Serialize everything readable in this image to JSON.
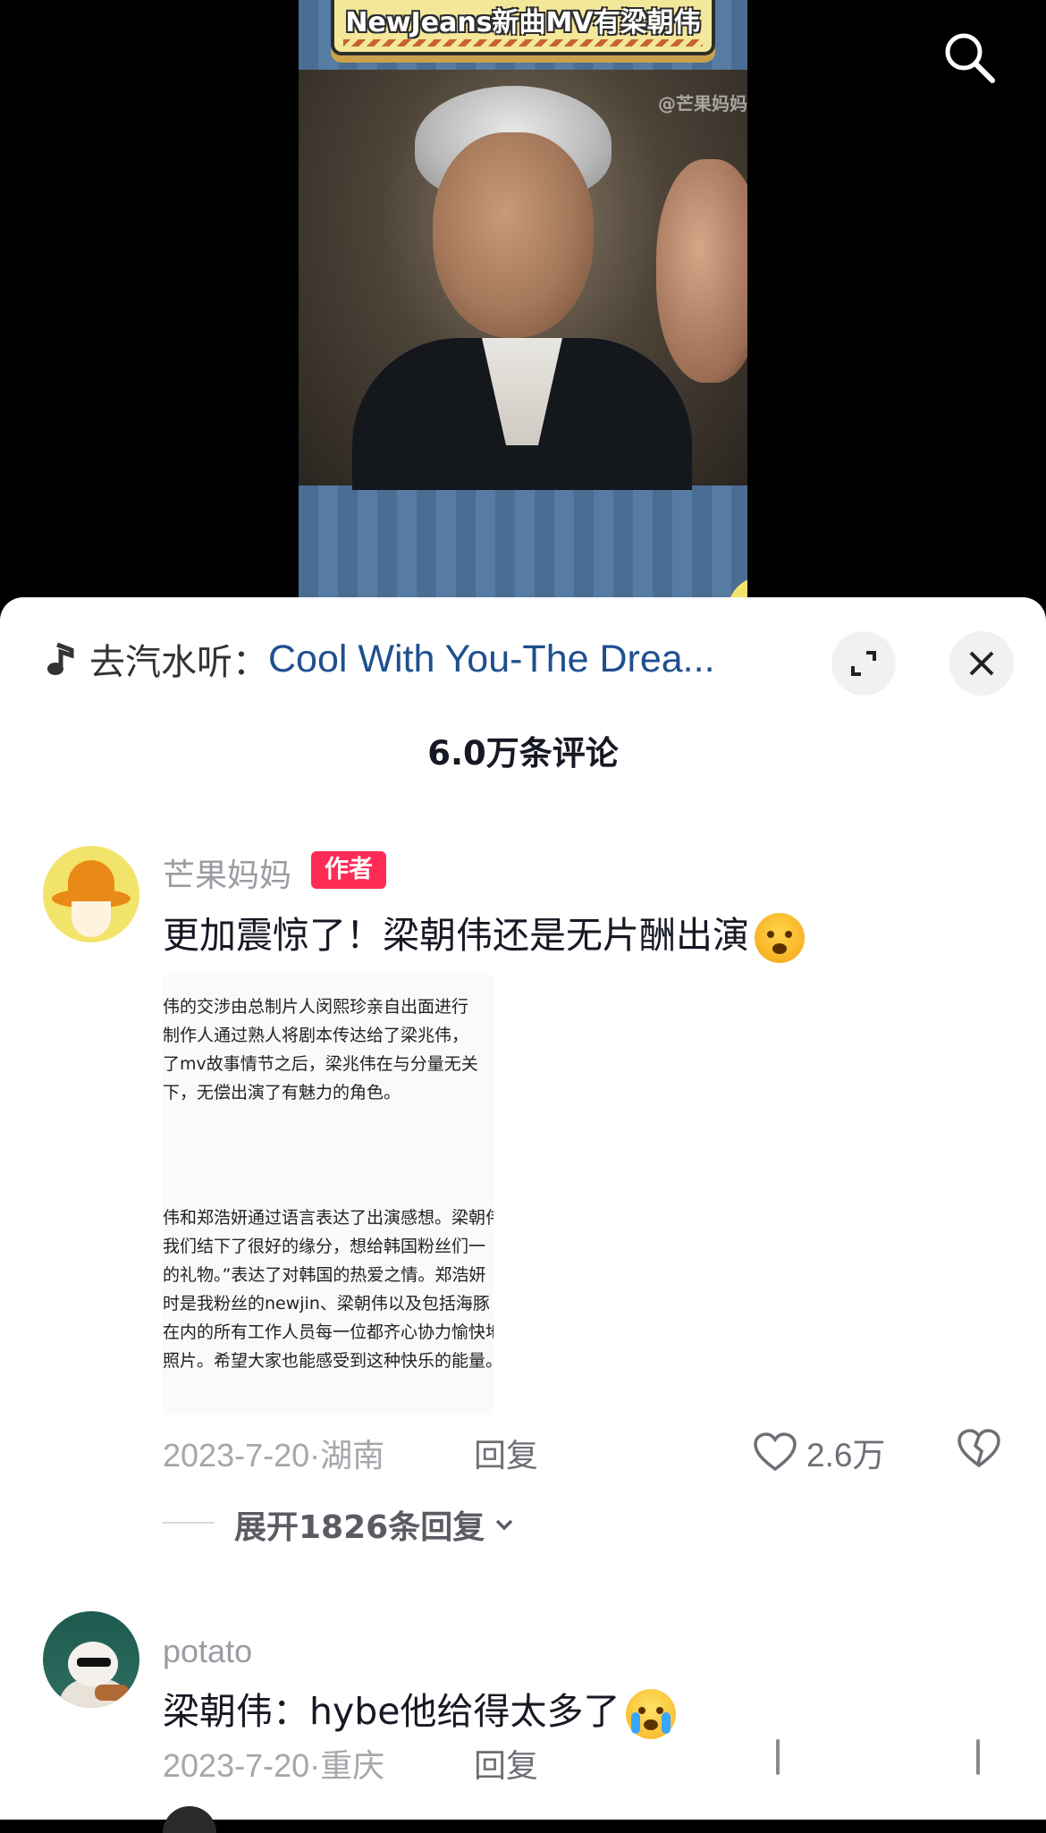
{
  "video": {
    "banner_text": "NewJeans新曲MV有梁朝伟",
    "watermark": "@芒果妈妈"
  },
  "top_bar": {
    "search_icon": "search-icon"
  },
  "music_bar": {
    "icon": "music-note-icon",
    "prefix": "去汽水听：",
    "song_title": "Cool With You-The Drea..."
  },
  "sheet": {
    "comment_count": "6.0万条评论"
  },
  "comments": [
    {
      "username": "芒果妈妈",
      "badge": "作者",
      "text": "更加震惊了！梁朝伟还是无片酬出演",
      "emoji": "angry-face-emoji",
      "image_paragraphs": [
        "伟的交涉由总制片人闵熙珍亲自出面进行\n制作人通过熟人将剧本传达给了梁兆伟，\n了mv故事情节之后，梁兆伟在与分量无关\n下，无偿出演了有魅力的角色。",
        "伟和郑浩妍通过语言表达了出演感想。梁朝伟\n我们结下了很好的缘分，想给韩国粉丝们一\n的礼物。”表达了对韩国的热爱之情。郑浩妍\n时是我粉丝的newjin、梁朝伟以及包括海豚\n在内的所有工作人员每一位都齐心协力愉快地\n照片。希望大家也能感受到这种快乐的能量。"
      ],
      "date": "2023-7-20",
      "location": "湖南",
      "reply_label": "回复",
      "likes": "2.6万",
      "expand_label": "展开1826条回复"
    },
    {
      "username": "potato",
      "text": "梁朝伟：hybe他给得太多了",
      "emoji": "crying-face-emoji",
      "date": "2023-7-20",
      "location": "重庆",
      "reply_label": "回复"
    }
  ],
  "colors": {
    "accent_link": "#1f4f8f",
    "author_badge": "#fe2c55",
    "sheet_bg": "#ffffff",
    "video_bg": "#000000"
  }
}
